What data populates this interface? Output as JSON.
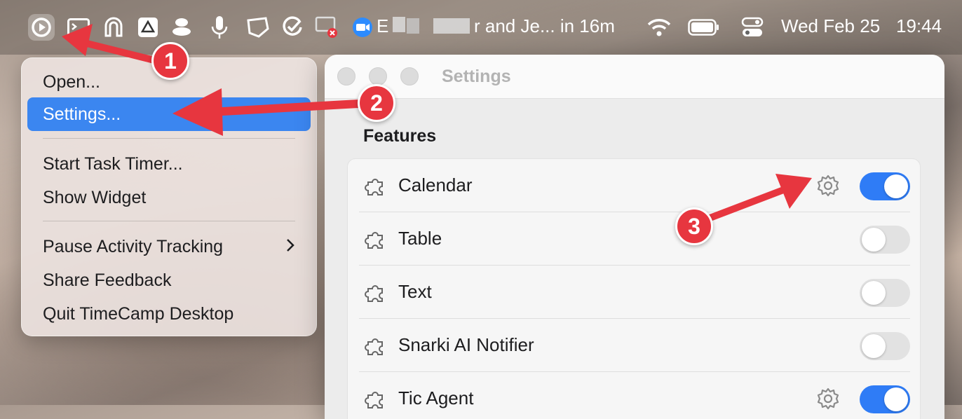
{
  "menubar": {
    "meeting_text_left": "E",
    "meeting_text": "r and Je... in 16m",
    "datetime": "Wed Feb 25",
    "time": "19:44",
    "icons": [
      "timecamp-icon",
      "terminal-icon",
      "magnet-icon",
      "drive-icon",
      "stack-icon",
      "microphone-icon",
      "screenshot-icon",
      "checkmark-icon",
      "screen-record-icon",
      "zoom-icon",
      "wifi-icon",
      "battery-icon",
      "control-center-icon"
    ]
  },
  "menu": {
    "items": [
      {
        "label": "Open..."
      },
      {
        "label": "Settings..."
      },
      {
        "label": "Start Task Timer..."
      },
      {
        "label": "Show Widget"
      },
      {
        "label": "Pause Activity Tracking"
      },
      {
        "label": "Share Feedback"
      },
      {
        "label": "Quit TimeCamp Desktop"
      }
    ],
    "selected": "Settings..."
  },
  "window": {
    "title": "Settings",
    "section": "Features",
    "features": [
      {
        "label": "Calendar",
        "has_settings": true,
        "enabled": true
      },
      {
        "label": "Table",
        "has_settings": false,
        "enabled": false
      },
      {
        "label": "Text",
        "has_settings": false,
        "enabled": false
      },
      {
        "label": "Snarki AI Notifier",
        "has_settings": false,
        "enabled": false
      },
      {
        "label": "Tic Agent",
        "has_settings": true,
        "enabled": true
      }
    ]
  },
  "annotations": {
    "badge1": "1",
    "badge2": "2",
    "badge3": "3",
    "color": "#e7363f"
  },
  "colors": {
    "accent": "#3b86f0",
    "toggle_on": "#2f7cf6"
  }
}
